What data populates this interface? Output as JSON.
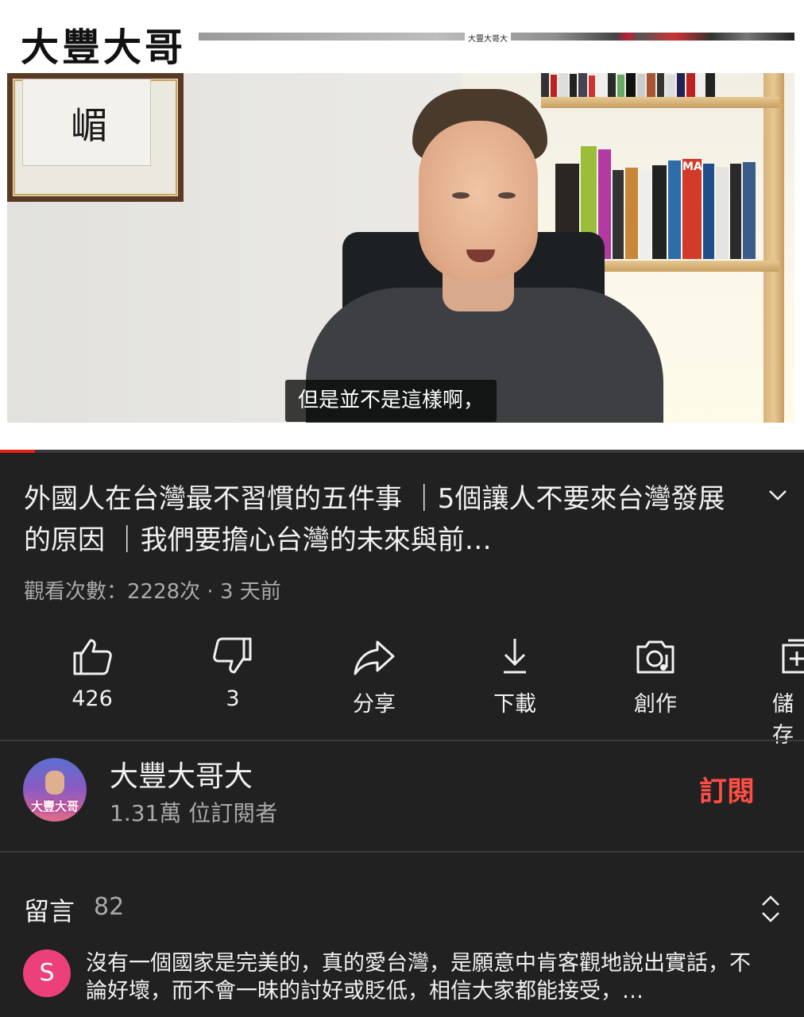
{
  "video": {
    "brand_logo": "大豐大哥",
    "strip_text": "大豐大哥大",
    "calligraphy": "嵋",
    "book_spine": "MAO",
    "subtitle": "但是並不是這樣啊，",
    "progress_fraction": 0.043,
    "accent_color": "#e62117"
  },
  "title": "外國人在台灣最不習慣的五件事 ｜5個讓人不要來台灣發展的原因 ｜我們要擔心台灣的未來與前…",
  "meta": "觀看次數：2228次 · 3 天前",
  "actions": [
    {
      "icon": "thumbs-up-icon",
      "label": "426"
    },
    {
      "icon": "thumbs-down-icon",
      "label": "3"
    },
    {
      "icon": "share-icon",
      "label": "分享"
    },
    {
      "icon": "download-icon",
      "label": "下載"
    },
    {
      "icon": "create-icon",
      "label": "創作"
    },
    {
      "icon": "save-icon",
      "label": "儲存"
    }
  ],
  "channel": {
    "name": "大豐大哥大",
    "subscribers": "1.31萬 位訂閱者",
    "avatar_text": "大豐大哥",
    "subscribe_label": "訂閱",
    "subscribe_color": "#ff4e45"
  },
  "comments": {
    "heading": "留言",
    "count": "82",
    "first": {
      "avatar_letter": "S",
      "avatar_color": "#ec407a",
      "text": "沒有一個國家是完美的，真的愛台灣，是願意中肯客觀地說出實話，不論好壞，而不會一昧的討好或貶低，相信大家都能接受，…"
    }
  }
}
